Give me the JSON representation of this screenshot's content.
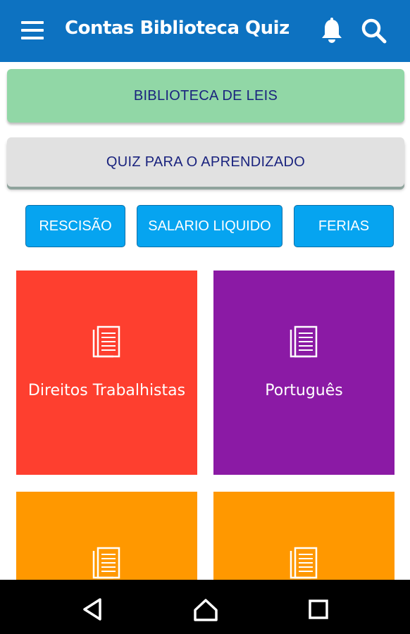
{
  "app_bar": {
    "title": "Contas Biblioteca Quiz",
    "background": "#0d72c1",
    "icons": [
      "menu-icon",
      "bell-icon",
      "search-icon"
    ]
  },
  "main_buttons": {
    "library_label": "BIBLIOTECA DE LEIS",
    "quiz_label": "QUIZ PARA O APRENDIZADO"
  },
  "quick_buttons": {
    "rescisao": "RESCISÃO",
    "salario": "SALARIO LIQUIDO",
    "ferias": "FERIAS"
  },
  "tiles": [
    {
      "label": "Direitos Trabalhistas",
      "color": "#fe3f2f",
      "icon": "document-icon"
    },
    {
      "label": "Português",
      "color": "#8b1aa5",
      "icon": "document-icon"
    },
    {
      "label": "",
      "color": "#ff9800",
      "icon": "document-icon"
    },
    {
      "label": "",
      "color": "#ff9800",
      "icon": "document-icon"
    }
  ],
  "nav_bar": {
    "icons": [
      "back-icon",
      "home-icon",
      "recent-apps-icon"
    ]
  }
}
